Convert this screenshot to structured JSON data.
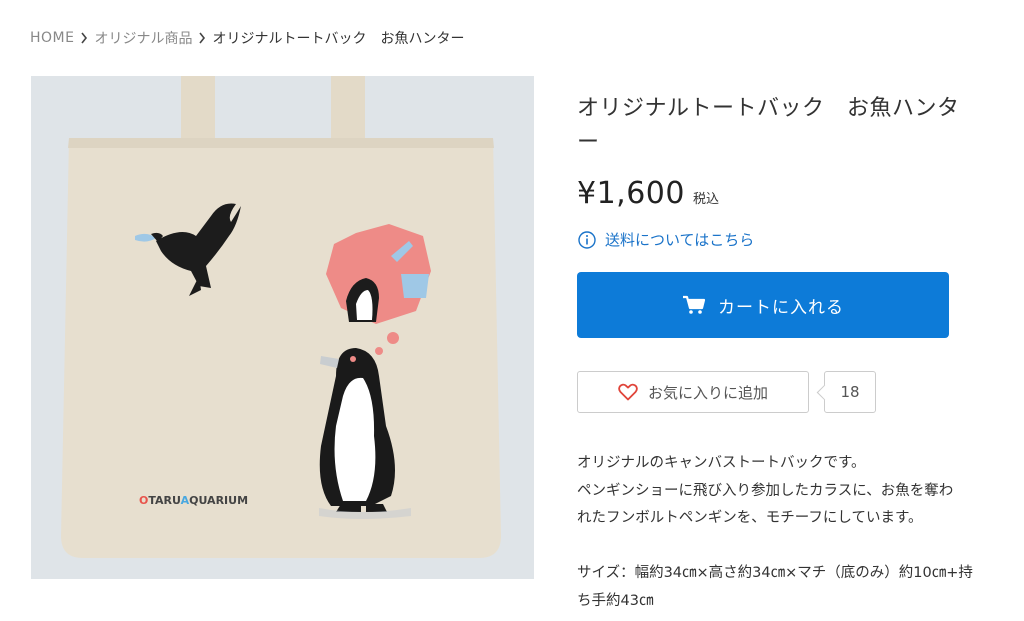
{
  "breadcrumb": {
    "home": "HOME",
    "category": "オリジナル商品",
    "current": "オリジナルトートバック　お魚ハンター"
  },
  "product": {
    "image_alt": "tote-bag-penguin-crow",
    "image_logo_text": {
      "part1": "O",
      "part2": "TARU",
      "part3": "A",
      "part4": "QUARIUM"
    },
    "title": "オリジナルトートバック　お魚ハンター",
    "price": "¥1,600",
    "tax_label": "税込",
    "shipping_link": "送料についてはこちら",
    "cart_button": "カートに入れる",
    "favorite_button": "お気に入りに追加",
    "favorite_count": "18",
    "description": [
      "オリジナルのキャンバストートバックです。",
      "ペンギンショーに飛び入り参加したカラスに、お魚を奪わ",
      "れたフンボルトペンギンを、モチーフにしています。",
      "",
      "サイズ：幅約34㎝×高さ約34㎝×マチ（底のみ）約10㎝+持",
      "ち手約43㎝"
    ]
  },
  "colors": {
    "accent": "#0d7bd8",
    "link": "#1a73c9",
    "heart": "#e0443a",
    "bag": "#e8e0d0",
    "bubble": "#f08a86"
  },
  "icons": {
    "separator": "chevron-right-icon",
    "info": "info-icon",
    "cart": "cart-icon",
    "favorite": "heart-icon"
  }
}
